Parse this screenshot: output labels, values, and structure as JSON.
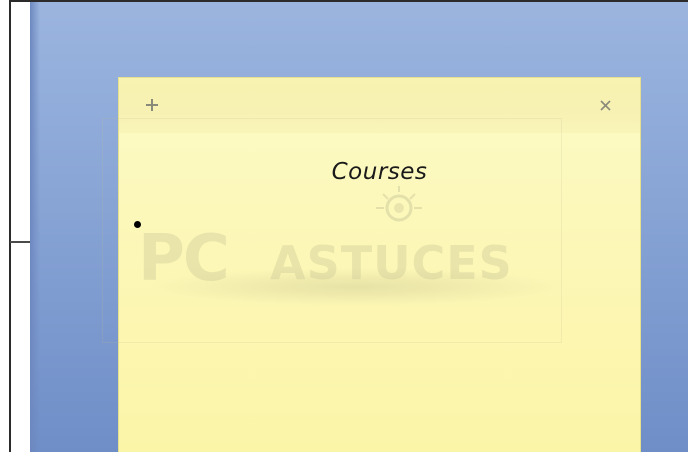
{
  "sticky_note": {
    "add_icon": "plus-icon",
    "close_icon": "close-icon",
    "title": "Courses",
    "bullet_icon": "bullet-icon"
  },
  "watermark": {
    "logo_text_pc": "PC",
    "logo_text_astuces": "ASTUCES"
  },
  "colors": {
    "note_background": "#fcf7b7",
    "note_header": "#f8f3b0",
    "desktop_blue": "#8aa6d6",
    "icon_gray": "#8a8a7a"
  }
}
